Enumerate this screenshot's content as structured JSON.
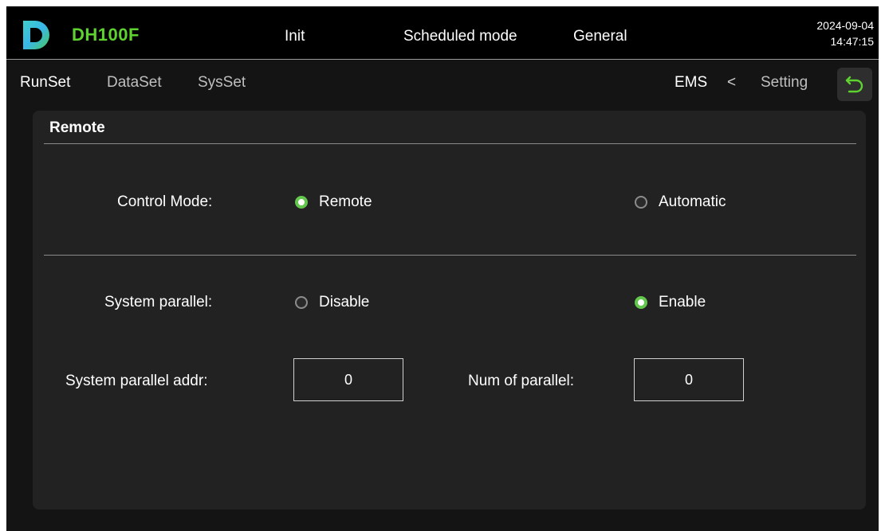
{
  "header": {
    "brand": "DH100F",
    "menu": [
      "Init",
      "Scheduled mode",
      "General"
    ],
    "date": "2024-09-04",
    "time": "14:47:15"
  },
  "subnav": {
    "tabs": [
      "RunSet",
      "DataSet",
      "SysSet"
    ],
    "breadcrumb": {
      "current": "EMS",
      "separator": "<",
      "parent": "Setting"
    }
  },
  "panel": {
    "title": "Remote",
    "control_mode": {
      "label": "Control Mode:",
      "options": [
        "Remote",
        "Automatic"
      ],
      "selected": "Remote"
    },
    "system_parallel": {
      "label": "System parallel:",
      "options": [
        "Disable",
        "Enable"
      ],
      "selected": "Enable"
    },
    "parallel_addr": {
      "label": "System parallel addr:",
      "value": "0"
    },
    "num_parallel": {
      "label": "Num of parallel:",
      "value": "0"
    }
  },
  "colors": {
    "accent_green": "#63c74d",
    "brand_green": "#5ed32f",
    "panel_bg": "#222222",
    "page_bg": "#141414"
  },
  "icons": [
    "logo-d-icon",
    "back-arrow-icon",
    "radio-icon"
  ]
}
